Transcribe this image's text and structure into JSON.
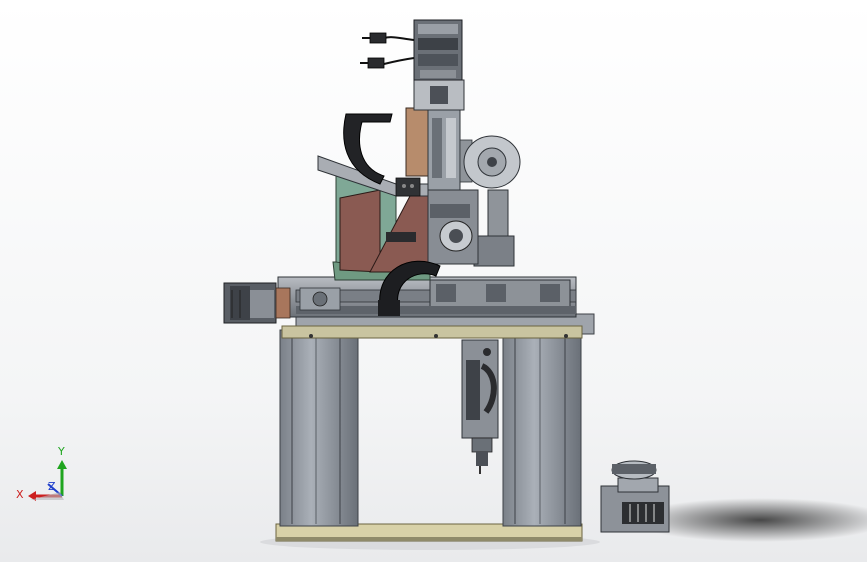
{
  "viewport": {
    "background": "#ffffff"
  },
  "triad": {
    "x_label": "X",
    "y_label": "Y",
    "z_label": "Z",
    "x_color": "#cc1f1f",
    "y_color": "#1fa51f",
    "z_color": "#1f3fcc"
  },
  "components": [
    "stepper-motor",
    "vertical-lead-screw-stage",
    "cable-drag-chain",
    "tape-reel",
    "horizontal-linear-stage",
    "servo-motor",
    "frame-base-plate",
    "nozzle-head",
    "feeder-box"
  ],
  "colors": {
    "steel": "#8c9096",
    "dark_steel": "#4b4f55",
    "frame": "#9da3ab",
    "frame_dark": "#6f757d",
    "base_plate": "#d8d1a8",
    "brown_plate": "#8a5a52",
    "green_plate": "#6f9a82",
    "tan_block": "#b78c6c",
    "black": "#1c1c1e"
  }
}
